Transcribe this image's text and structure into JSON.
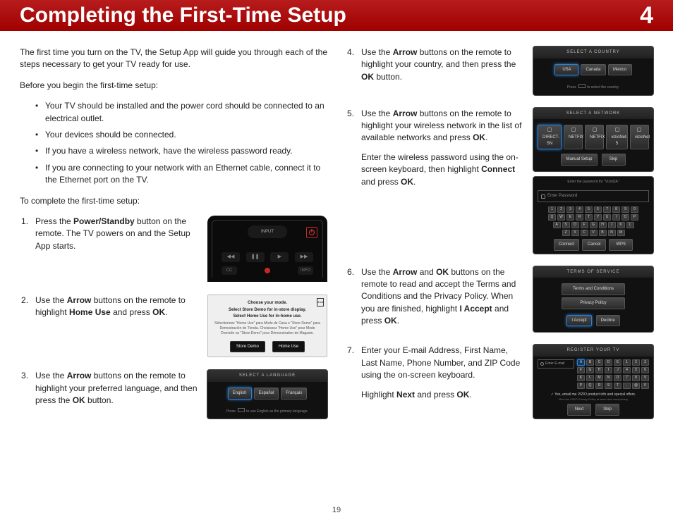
{
  "header": {
    "title": "Completing the First-Time Setup",
    "chapter_number": "4"
  },
  "footer": {
    "page_number": "19"
  },
  "left": {
    "intro_para": "The first time you turn on the TV, the Setup App will guide you through each of the steps necessary to get your TV ready for use.",
    "before_heading": "Before you begin the first-time setup:",
    "prep_bullets": [
      "Your TV should be installed and the power cord should be connected to an electrical outlet.",
      "Your devices should be connected.",
      "If you have a wireless network, have the wireless password ready.",
      "If you are connecting to your network with an Ethernet cable, connect it to the Ethernet port on the TV."
    ],
    "complete_heading": "To complete the first-time setup:",
    "step1": {
      "pre": "Press the ",
      "b": "Power/Standby",
      "post": " button on the remote. The TV powers on and the Setup App starts."
    },
    "step2": {
      "pre": "Use the ",
      "b1": "Arrow",
      "mid": " buttons on the remote to highlight ",
      "b2": "Home Use",
      "post": " and press ",
      "b3": "OK",
      "end": "."
    },
    "step3": {
      "pre": "Use the ",
      "b1": "Arrow",
      "mid": " buttons on the remote to highlight your preferred language, and then press the ",
      "b2": "OK",
      "post": " button."
    }
  },
  "right": {
    "step4": {
      "pre": "Use the ",
      "b1": "Arrow",
      "mid": " buttons on the remote to highlight your country, and then press the ",
      "b2": "OK",
      "post": " button."
    },
    "step5a": {
      "pre": "Use the ",
      "b1": "Arrow",
      "mid": " buttons on the remote to highlight your wireless network in the list of available networks and press ",
      "b2": "OK",
      "post": "."
    },
    "step5b": {
      "pre": "Enter the wireless password using the on-screen keyboard, then highlight ",
      "b1": "Connect",
      "mid": " and press ",
      "b2": "OK",
      "post": "."
    },
    "step6": {
      "pre": "Use the ",
      "b1": "Arrow",
      "mid1": " and ",
      "b2": "OK",
      "mid2": " buttons on the remote to read and accept the Terms and Conditions and the Privacy Policy. When you are finished, highlight ",
      "b3": "I Accept",
      "mid3": " and press ",
      "b4": "OK",
      "post": "."
    },
    "step7a": "Enter your E-mail Address, First Name, Last Name, Phone Number, and ZIP Code using the on-screen keyboard.",
    "step7b": {
      "pre": "Highlight ",
      "b1": "Next",
      "mid": " and press ",
      "b2": "OK",
      "post": "."
    }
  },
  "screens": {
    "remote": {
      "input_label": "INPUT"
    },
    "mode": {
      "l1": "Choose your mode.",
      "l2": "Select Store Demo for in-store display.",
      "l3": "Select Home Use for in-home use.",
      "sub": "Sélectionnez \"Home Use\" para Modo de Casa o \"Store Demo\" para Demostración de Tienda. Choisissez \"Home Use\" pour Mode Domicile ou \"Store Demo\" pour Démonstration de Magasin.",
      "btn1": "Store Demo",
      "btn2": "Home Use",
      "tag": "Mode"
    },
    "language": {
      "title": "SELECT A LANGUAGE",
      "opts": [
        "English",
        "Español",
        "Français"
      ],
      "foot": "to use English as the primary language.",
      "foot_pre": "Press "
    },
    "country": {
      "title": "SELECT A COUNTRY",
      "opts": [
        "USA",
        "Canada",
        "Mexico"
      ],
      "foot_pre": "Press ",
      "foot": "to select the country."
    },
    "network": {
      "title": "SELECT A NETWORK",
      "nets": [
        "DIRECT-SN",
        "NETFIX",
        "NETFIX",
        "vizioNet-5",
        "vizioNet"
      ],
      "btn1": "Manual Setup",
      "btn2": "Skip"
    },
    "password": {
      "prompt": "Enter the password for \"VizioQA\"",
      "placeholder": "Enter Password",
      "row1": [
        "1",
        "2",
        "3",
        "4",
        "5",
        "6",
        "7",
        "8",
        "9",
        "0"
      ],
      "row2": [
        "Q",
        "W",
        "E",
        "R",
        "T",
        "Y",
        "U",
        "I",
        "O",
        "P"
      ],
      "row3": [
        "A",
        "S",
        "D",
        "F",
        "G",
        "H",
        "J",
        "K",
        "L"
      ],
      "row4": [
        "Z",
        "X",
        "C",
        "V",
        "B",
        "N",
        "M"
      ],
      "btn1": "Connect",
      "btn2": "Cancel",
      "btn3": "WPS"
    },
    "terms": {
      "title": "TERMS OF SERVICE",
      "b1": "Terms and Conditions",
      "b2": "Privacy Policy",
      "accept": "I Accept",
      "decline": "Decline"
    },
    "register": {
      "title": "REGISTER YOUR TV",
      "field": "Enter E-mail",
      "row1": [
        "A",
        "B",
        "C",
        "D",
        "E",
        "1",
        "2",
        "3"
      ],
      "row2": [
        "F",
        "G",
        "H",
        "I",
        "J",
        "4",
        "5",
        "6"
      ],
      "row3": [
        "K",
        "L",
        "M",
        "N",
        "O",
        "7",
        "8",
        "9"
      ],
      "row4": [
        "P",
        "Q",
        "R",
        "S",
        "T",
        ".",
        "@",
        "0"
      ],
      "chk": "Yes, email me VIZIO product info and special offers.",
      "sub": "View the VIZIO Privacy Policy at www.vizio.com/privacy",
      "btn1": "Next",
      "btn2": "Skip"
    }
  }
}
